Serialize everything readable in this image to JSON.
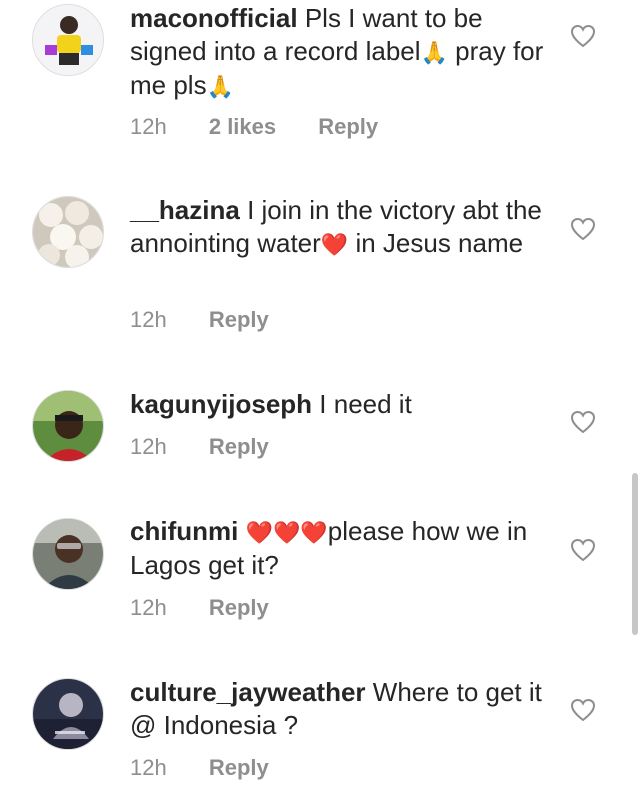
{
  "comments": [
    {
      "username": "maconofficial",
      "text_parts": [
        "Pls I want to be signed into a record label",
        "🙏",
        " pray for me pls",
        "🙏"
      ],
      "time": "12h",
      "likes": "2 likes",
      "reply": "Reply"
    },
    {
      "username": "__hazina",
      "text_parts": [
        "I join in the victory abt the annointing water",
        "❤️",
        " in Jesus name"
      ],
      "time": "12h",
      "reply": "Reply"
    },
    {
      "username": "kagunyijoseph",
      "text_parts": [
        "I need it"
      ],
      "time": "12h",
      "reply": "Reply"
    },
    {
      "username": "chifunmi",
      "text_parts": [
        "❤️❤️❤️",
        "please how we in Lagos get it?"
      ],
      "time": "12h",
      "reply": "Reply"
    },
    {
      "username": "culture_jayweather",
      "text_parts": [
        "Where to get it @ Indonesia ?"
      ],
      "time": "12h",
      "reply": "Reply"
    }
  ],
  "icons": {
    "like": "heart-outline-icon"
  },
  "colors": {
    "text": "#262626",
    "meta": "#8e8e8e",
    "heart_emoji": "#e0262f"
  }
}
